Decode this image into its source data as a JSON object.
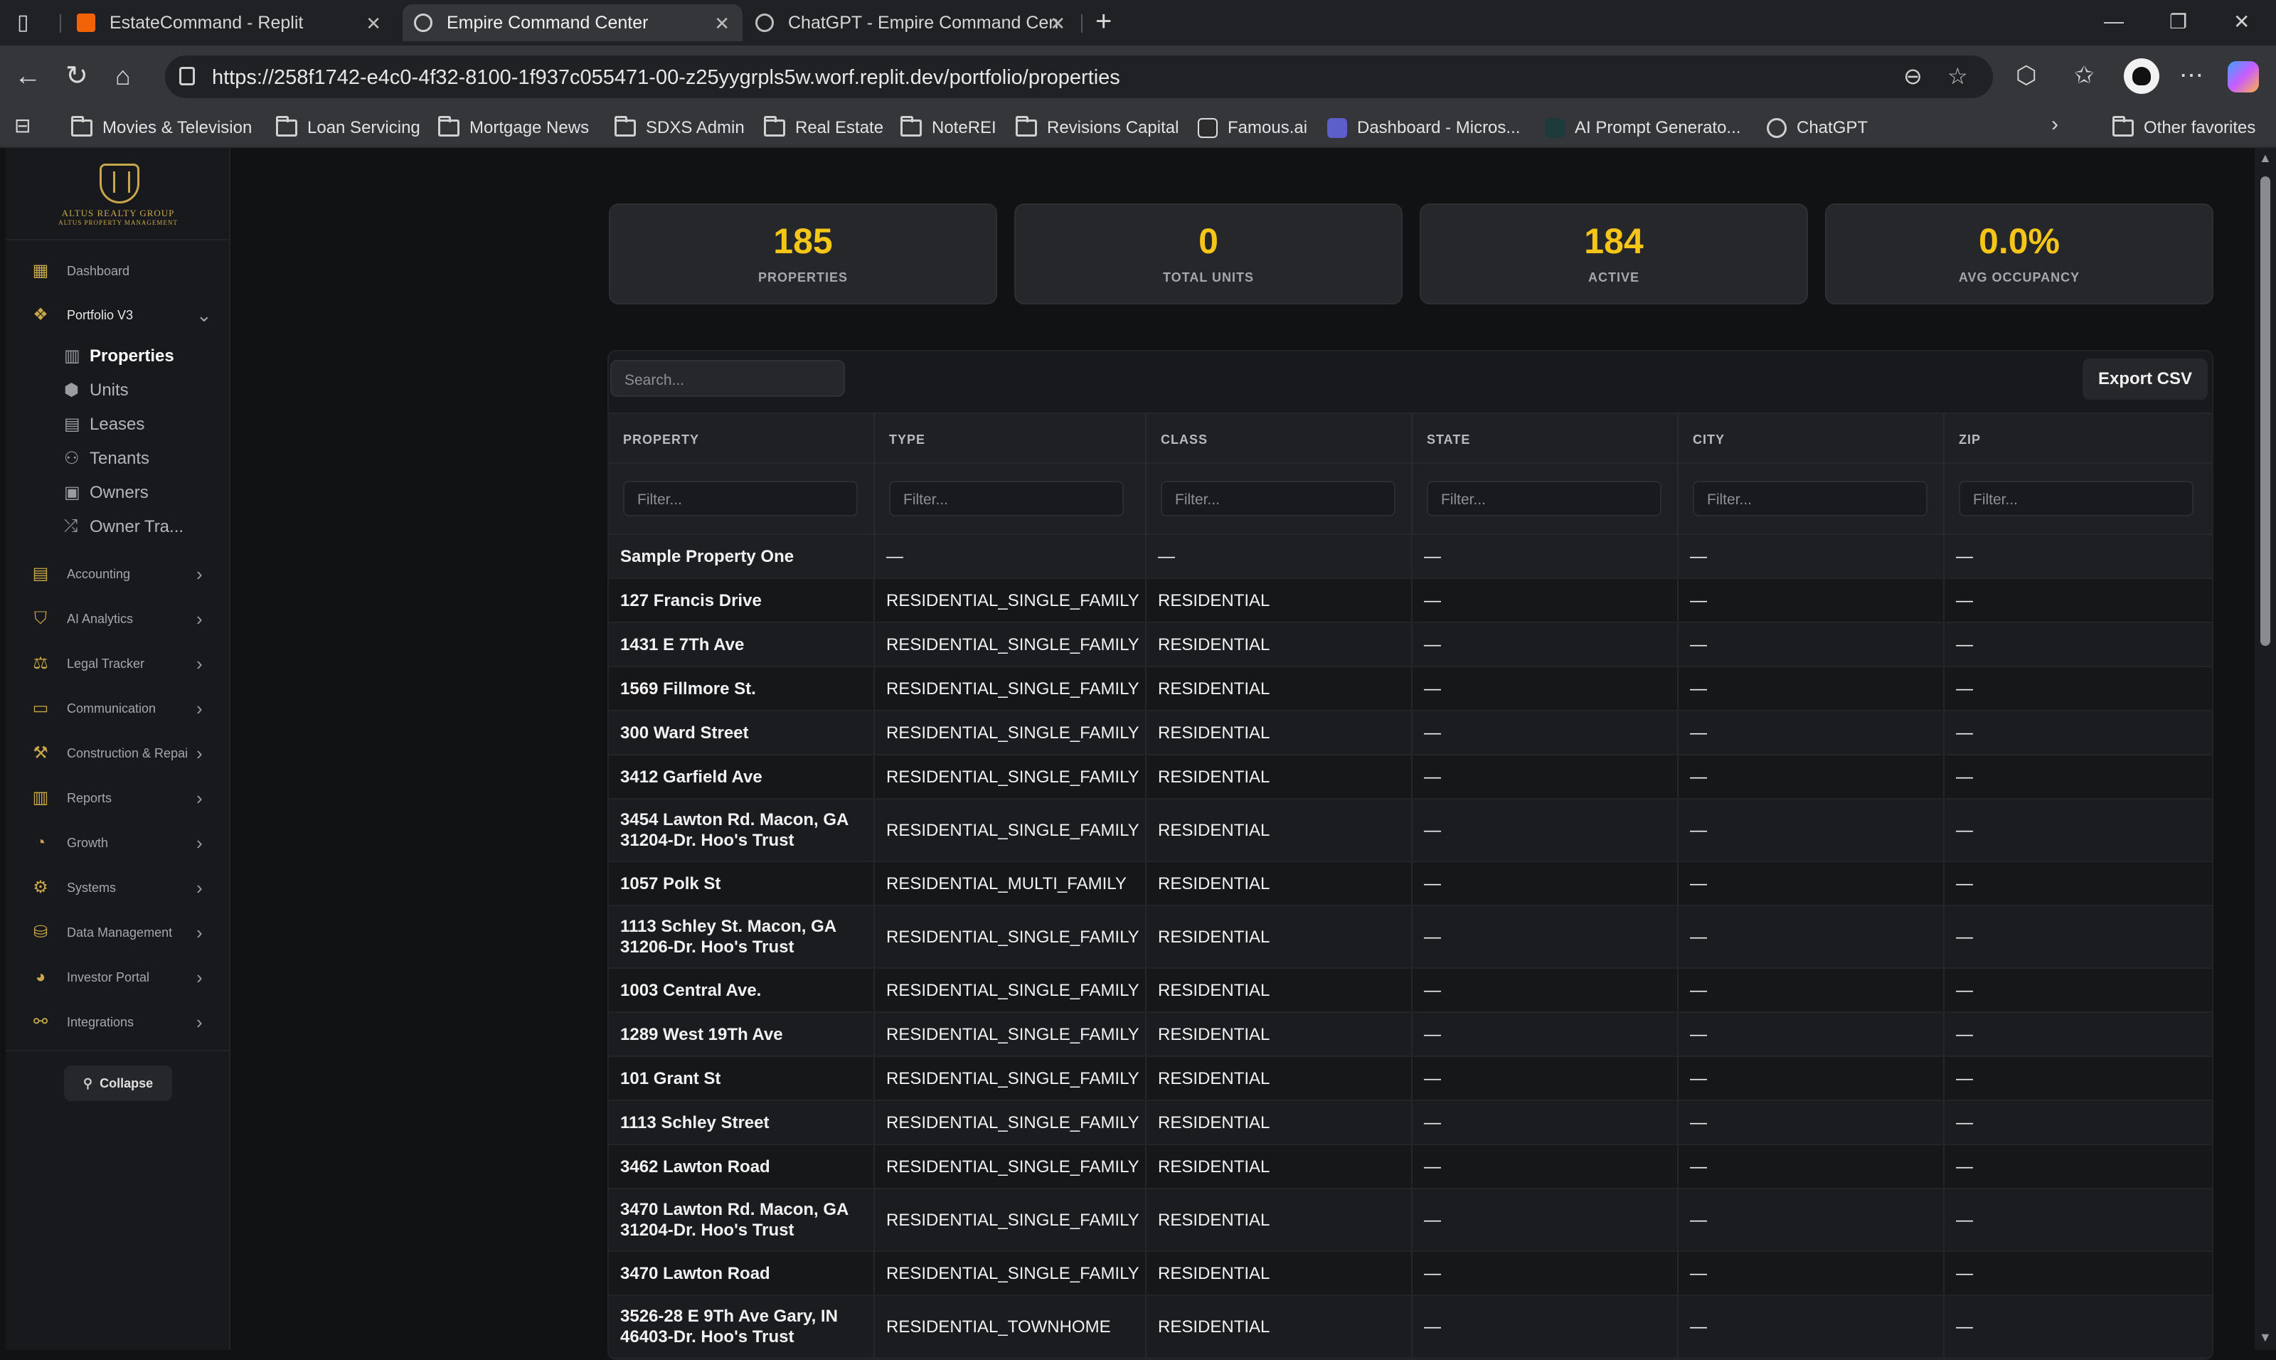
{
  "browser": {
    "tabs": [
      {
        "title": "EstateCommand - Replit",
        "icon": "replit-icon"
      },
      {
        "title": "Empire Command Center",
        "icon": "globe-icon"
      },
      {
        "title": "ChatGPT - Empire Command Cen",
        "icon": "chatgpt-icon"
      }
    ],
    "url": "https://258f1742-e4c0-4f32-8100-1f937c055471-00-z25yygrpls5w.worf.replit.dev/portfolio/properties",
    "bookmarks": [
      "Movies & Television",
      "Loan Servicing",
      "Mortgage News",
      "SDXS Admin",
      "Real Estate",
      "NoteREI",
      "Revisions Capital",
      "Famous.ai",
      "Dashboard - Micros...",
      "AI Prompt Generato...",
      "ChatGPT"
    ],
    "other_favorites": "Other favorites"
  },
  "sidebar": {
    "logo_line1": "ALTUS REALTY GROUP",
    "logo_line2": "ALTUS PROPERTY MANAGEMENT",
    "dashboard": "Dashboard",
    "portfolio": "Portfolio V3",
    "sub_items": [
      "Properties",
      "Units",
      "Leases",
      "Tenants",
      "Owners",
      "Owner Tra..."
    ],
    "sections": [
      "Accounting",
      "AI Analytics",
      "Legal Tracker",
      "Communication",
      "Construction & Repai",
      "Reports",
      "Growth",
      "Systems",
      "Data Management",
      "Investor Portal",
      "Integrations"
    ],
    "collapse": "Collapse"
  },
  "stats": [
    {
      "value": "185",
      "label": "PROPERTIES"
    },
    {
      "value": "0",
      "label": "TOTAL UNITS"
    },
    {
      "value": "184",
      "label": "ACTIVE"
    },
    {
      "value": "0.0%",
      "label": "AVG OCCUPANCY"
    }
  ],
  "table": {
    "search_placeholder": "Search...",
    "export_label": "Export CSV",
    "filter_placeholder": "Filter...",
    "columns": [
      "PROPERTY",
      "TYPE",
      "CLASS",
      "STATE",
      "CITY",
      "ZIP"
    ],
    "rows": [
      [
        "Sample Property One",
        "—",
        "—",
        "—",
        "—",
        "—"
      ],
      [
        "127 Francis Drive",
        "RESIDENTIAL_SINGLE_FAMILY",
        "RESIDENTIAL",
        "—",
        "—",
        "—"
      ],
      [
        "1431 E 7Th Ave",
        "RESIDENTIAL_SINGLE_FAMILY",
        "RESIDENTIAL",
        "—",
        "—",
        "—"
      ],
      [
        "1569 Fillmore St.",
        "RESIDENTIAL_SINGLE_FAMILY",
        "RESIDENTIAL",
        "—",
        "—",
        "—"
      ],
      [
        "300 Ward Street",
        "RESIDENTIAL_SINGLE_FAMILY",
        "RESIDENTIAL",
        "—",
        "—",
        "—"
      ],
      [
        "3412 Garfield Ave",
        "RESIDENTIAL_SINGLE_FAMILY",
        "RESIDENTIAL",
        "—",
        "—",
        "—"
      ],
      [
        "3454 Lawton Rd. Macon, GA 31204-Dr. Hoo's Trust",
        "RESIDENTIAL_SINGLE_FAMILY",
        "RESIDENTIAL",
        "—",
        "—",
        "—"
      ],
      [
        "1057 Polk St",
        "RESIDENTIAL_MULTI_FAMILY",
        "RESIDENTIAL",
        "—",
        "—",
        "—"
      ],
      [
        "1113 Schley St. Macon, GA 31206-Dr. Hoo's Trust",
        "RESIDENTIAL_SINGLE_FAMILY",
        "RESIDENTIAL",
        "—",
        "—",
        "—"
      ],
      [
        "1003 Central Ave.",
        "RESIDENTIAL_SINGLE_FAMILY",
        "RESIDENTIAL",
        "—",
        "—",
        "—"
      ],
      [
        "1289 West 19Th Ave",
        "RESIDENTIAL_SINGLE_FAMILY",
        "RESIDENTIAL",
        "—",
        "—",
        "—"
      ],
      [
        "101 Grant St",
        "RESIDENTIAL_SINGLE_FAMILY",
        "RESIDENTIAL",
        "—",
        "—",
        "—"
      ],
      [
        "1113 Schley Street",
        "RESIDENTIAL_SINGLE_FAMILY",
        "RESIDENTIAL",
        "—",
        "—",
        "—"
      ],
      [
        "3462 Lawton Road",
        "RESIDENTIAL_SINGLE_FAMILY",
        "RESIDENTIAL",
        "—",
        "—",
        "—"
      ],
      [
        "3470 Lawton Rd. Macon, GA 31204-Dr. Hoo's Trust",
        "RESIDENTIAL_SINGLE_FAMILY",
        "RESIDENTIAL",
        "—",
        "—",
        "—"
      ],
      [
        "3470 Lawton Road",
        "RESIDENTIAL_SINGLE_FAMILY",
        "RESIDENTIAL",
        "—",
        "—",
        "—"
      ],
      [
        "3526-28 E 9Th Ave Gary, IN 46403-Dr. Hoo's Trust",
        "RESIDENTIAL_TOWNHOME",
        "RESIDENTIAL",
        "—",
        "—",
        "—"
      ]
    ]
  },
  "colors": {
    "accent": "#f5c518",
    "gold": "#c8a64a",
    "background": "#111214"
  }
}
